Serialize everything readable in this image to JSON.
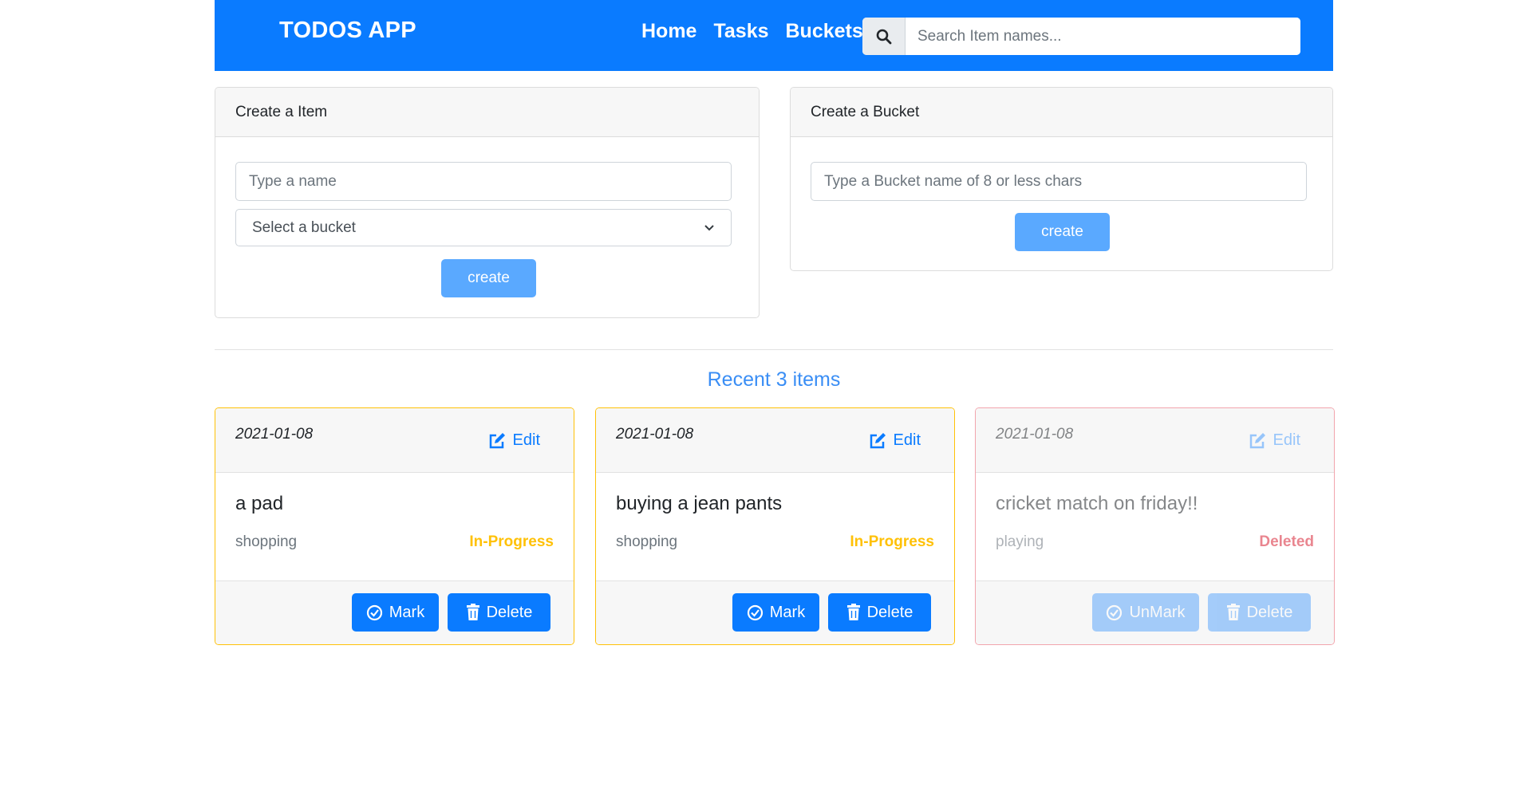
{
  "navbar": {
    "brand": "TODOS APP",
    "links": [
      "Home",
      "Tasks",
      "Buckets"
    ],
    "search_placeholder": "Search Item names..."
  },
  "create_item": {
    "header": "Create a Item",
    "name_placeholder": "Type a name",
    "bucket_select": "Select a bucket",
    "button": "create"
  },
  "create_bucket": {
    "header": "Create a Bucket",
    "name_placeholder": "Type a Bucket name of 8 or less chars",
    "button": "create"
  },
  "recent": {
    "title": "Recent 3 items",
    "items": [
      {
        "date": "2021-01-08",
        "edit": "Edit",
        "name": "a pad",
        "bucket": "shopping",
        "status": "In-Progress",
        "mark_label": "Mark",
        "delete_label": "Delete"
      },
      {
        "date": "2021-01-08",
        "edit": "Edit",
        "name": "buying a jean pants",
        "bucket": "shopping",
        "status": "In-Progress",
        "mark_label": "Mark",
        "delete_label": "Delete"
      },
      {
        "date": "2021-01-08",
        "edit": "Edit",
        "name": "cricket match on friday!!",
        "bucket": "playing",
        "status": "Deleted",
        "mark_label": "UnMark",
        "delete_label": "Delete"
      }
    ]
  },
  "colors": {
    "primary": "#0a7bff",
    "warning": "#ffc107",
    "danger": "#dc3545",
    "create_button": "#5aa9ff"
  },
  "icons": [
    "search-icon",
    "edit-icon",
    "check-circle-icon",
    "trash-icon",
    "chevron-down-icon"
  ]
}
